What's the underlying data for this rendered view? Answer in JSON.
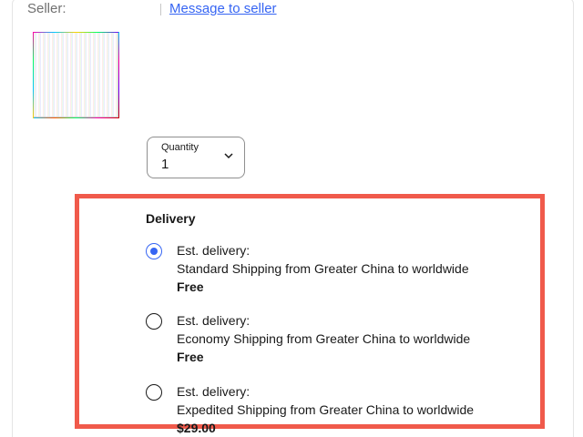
{
  "seller": {
    "label": "Seller:",
    "message_link": "Message to seller"
  },
  "quantity": {
    "label": "Quantity",
    "value": "1",
    "icon": "chevron-down-icon"
  },
  "delivery": {
    "title": "Delivery",
    "options": [
      {
        "est_label": "Est. delivery:",
        "method": "Standard Shipping from Greater China to worldwide",
        "price": "Free",
        "selected": true
      },
      {
        "est_label": "Est. delivery:",
        "method": "Economy Shipping from Greater China to worldwide",
        "price": "Free",
        "selected": false
      },
      {
        "est_label": "Est. delivery:",
        "method": "Expedited Shipping from Greater China to worldwide",
        "price": "$29.00",
        "selected": false
      }
    ]
  },
  "colors": {
    "accent": "#3665f3",
    "highlight_border": "#f05a4b",
    "text": "#191919",
    "muted": "#707070"
  }
}
